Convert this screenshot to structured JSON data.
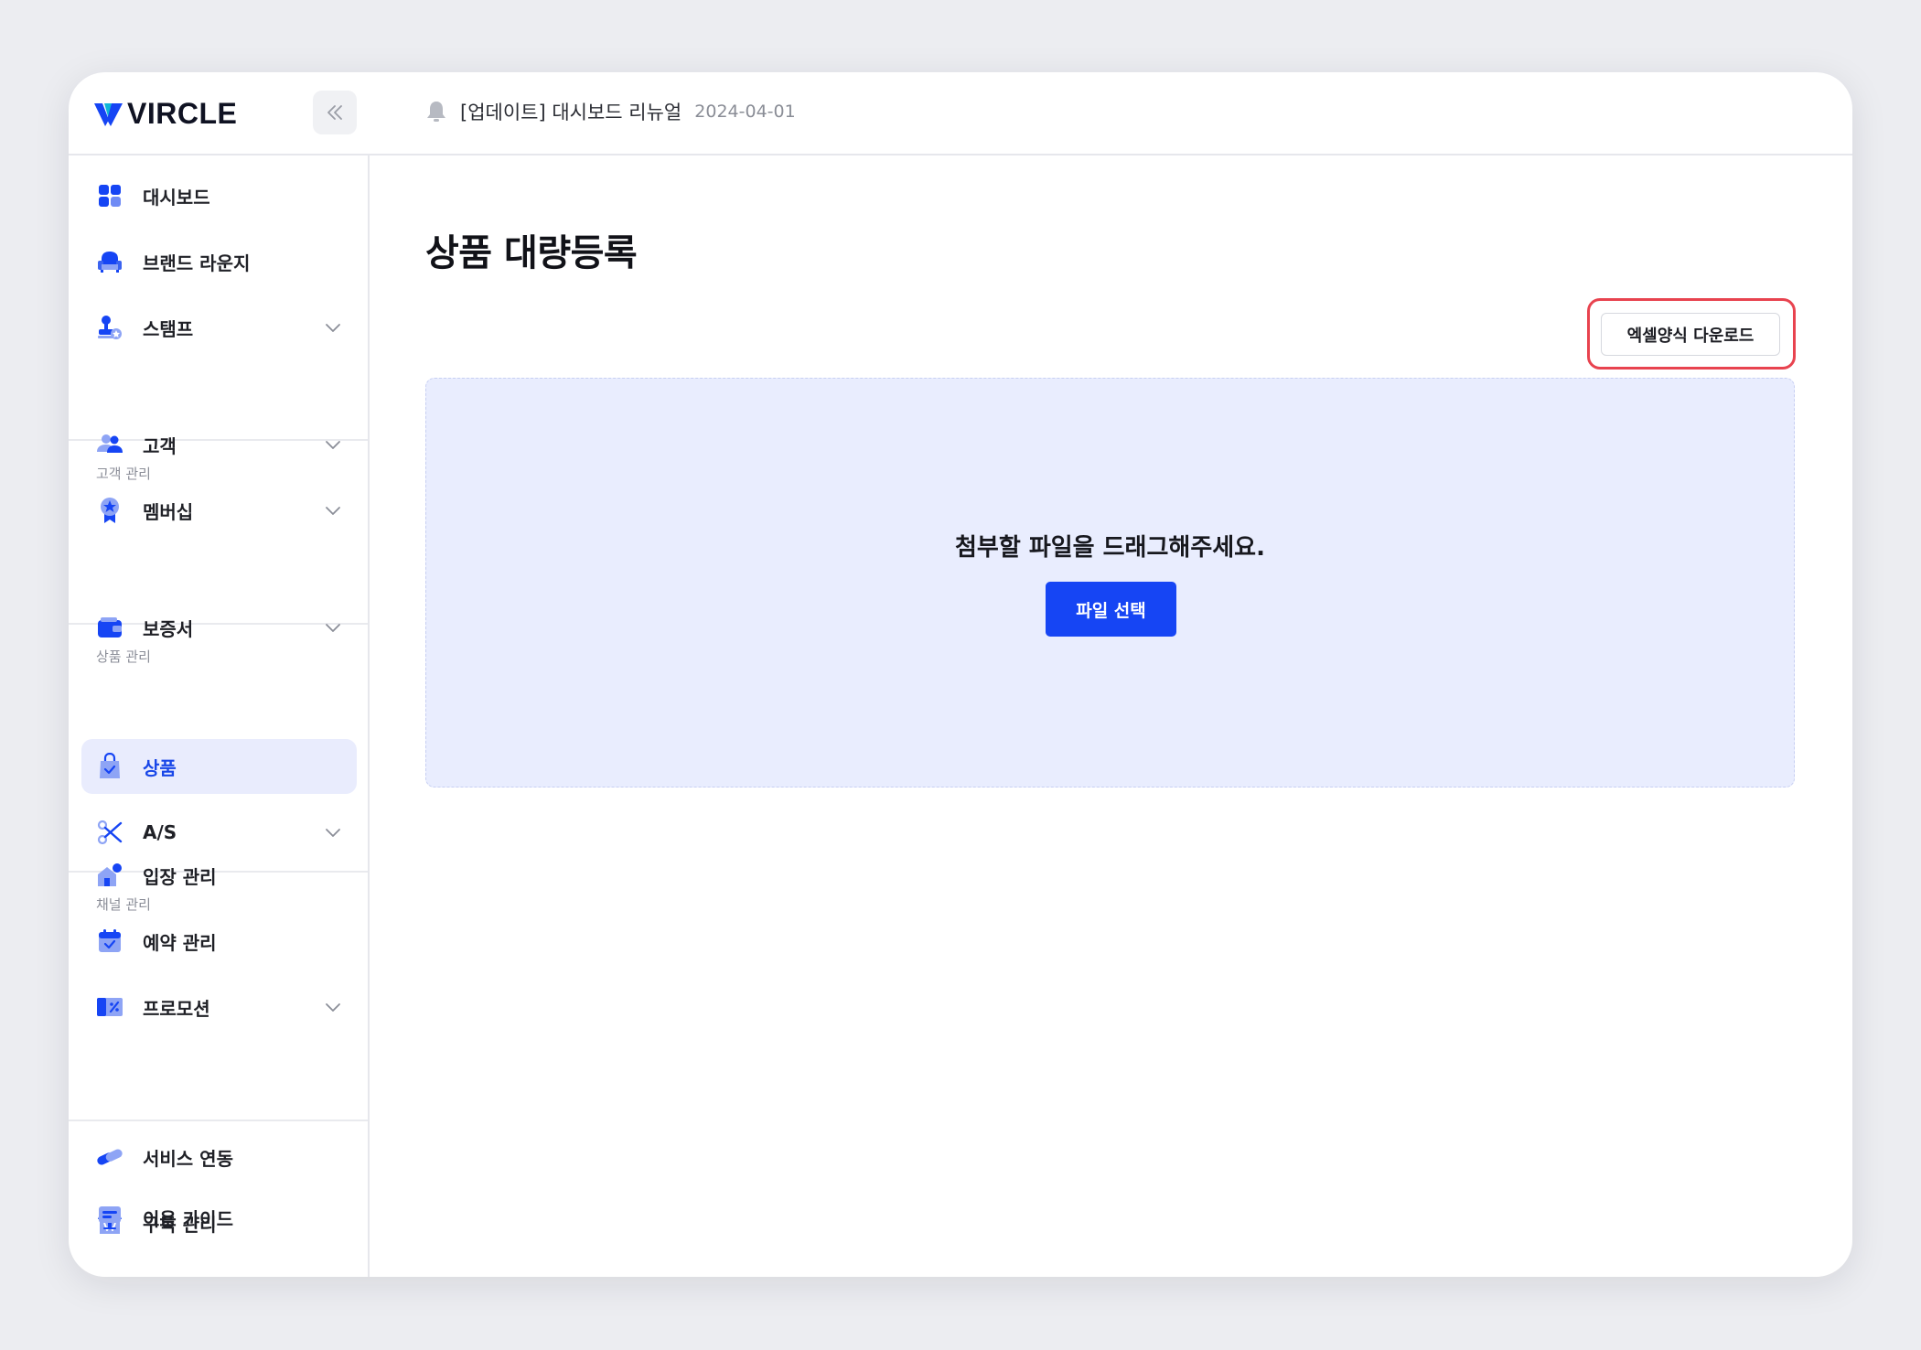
{
  "brand": {
    "name": "VIRCLE",
    "accent": "#1645f4"
  },
  "topbar": {
    "notice_text": "[업데이트] 대시보드 리뉴얼",
    "notice_date": "2024-04-01"
  },
  "sidebar": {
    "group1": [
      {
        "label": "대시보드",
        "icon": "dashboard-icon",
        "expandable": false
      },
      {
        "label": "브랜드 라운지",
        "icon": "armchair-icon",
        "expandable": false
      },
      {
        "label": "스탬프",
        "icon": "stamp-icon",
        "expandable": true
      }
    ],
    "section_customers": "고객 관리",
    "group2": [
      {
        "label": "고객",
        "icon": "users-icon",
        "expandable": true
      },
      {
        "label": "멤버십",
        "icon": "membership-badge-icon",
        "expandable": true
      }
    ],
    "section_products": "상품 관리",
    "group3": [
      {
        "label": "보증서",
        "icon": "wallet-icon",
        "expandable": true
      },
      {
        "label": "상품",
        "icon": "shopping-bag-icon",
        "expandable": false,
        "active": true
      },
      {
        "label": "A/S",
        "icon": "scissors-icon",
        "expandable": true
      }
    ],
    "section_channels": "채널 관리",
    "group4": [
      {
        "label": "입장 관리",
        "icon": "store-icon",
        "expandable": false
      },
      {
        "label": "예약 관리",
        "icon": "calendar-icon",
        "expandable": false
      },
      {
        "label": "프로모션",
        "icon": "coupon-icon",
        "expandable": true
      }
    ],
    "group5": [
      {
        "label": "서비스 연동",
        "icon": "link-icon",
        "expandable": false
      },
      {
        "label": "구독 관리",
        "icon": "subscription-icon",
        "expandable": false
      },
      {
        "label": "이용 가이드",
        "icon": "guide-icon",
        "expandable": false
      }
    ]
  },
  "main": {
    "title": "상품 대량등록",
    "excel_download_label": "엑셀양식 다운로드",
    "dropzone_text": "첨부할 파일을 드래그해주세요.",
    "file_select_label": "파일 선택"
  }
}
